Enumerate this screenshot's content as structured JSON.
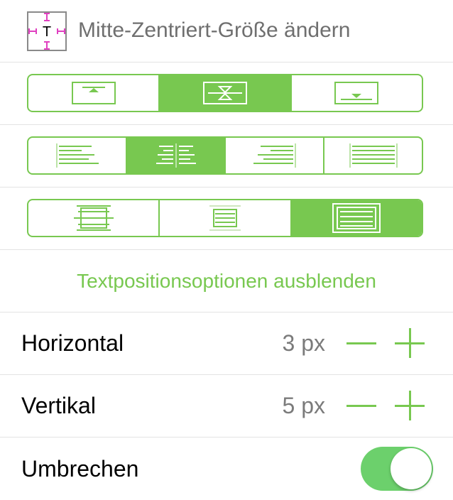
{
  "header": {
    "title": "Mitte-Zentriert-Größe ändern",
    "icon": "resize-center-icon",
    "icon_letter": "T"
  },
  "colors": {
    "accent": "#78c850",
    "toggle_on": "#6cd06c",
    "value_gray": "#7b7b7b",
    "icon_magenta": "#e040c0"
  },
  "vertical_alignment": {
    "options": [
      "top",
      "middle",
      "bottom"
    ],
    "selected": "middle"
  },
  "horizontal_alignment": {
    "options": [
      "left",
      "center",
      "right",
      "justified"
    ],
    "selected": "center"
  },
  "text_fit": {
    "options": [
      "overflow",
      "clip",
      "fit"
    ],
    "selected": "fit"
  },
  "link": {
    "label": "Textpositionsoptionen ausblenden"
  },
  "horizontal": {
    "label": "Horizontal",
    "value": "3 px"
  },
  "vertical": {
    "label": "Vertikal",
    "value": "5 px"
  },
  "wrap": {
    "label": "Umbrechen",
    "on": true
  }
}
